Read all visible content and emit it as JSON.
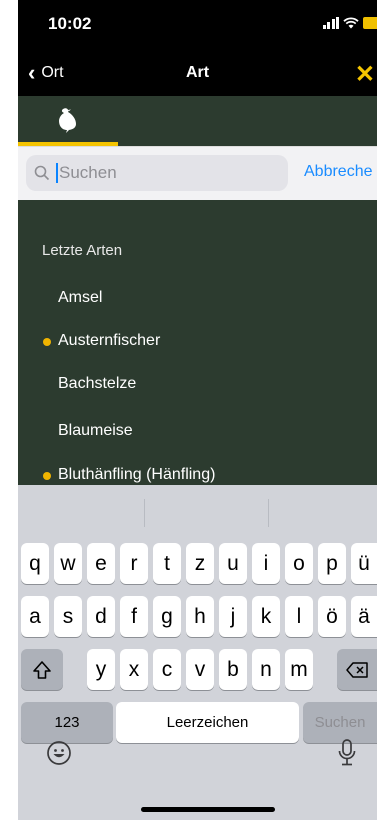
{
  "status": {
    "time": "10:02"
  },
  "nav": {
    "back_label": "Ort",
    "title": "Art",
    "close_symbol": "✕"
  },
  "tabs": [
    {
      "icon": "bird-icon",
      "active": true
    }
  ],
  "search": {
    "placeholder": "Suchen",
    "cancel_label": "Abbreche"
  },
  "list": {
    "section_title": "Letzte Arten",
    "items": [
      {
        "label": "Amsel",
        "marked": false
      },
      {
        "label": "Austernfischer",
        "marked": true
      },
      {
        "label": "Bachstelze",
        "marked": false
      },
      {
        "label": "Blaumeise",
        "marked": false
      },
      {
        "label": "Bluthänfling (Hänfling)",
        "marked": true
      }
    ]
  },
  "keyboard": {
    "row1": [
      "q",
      "w",
      "e",
      "r",
      "t",
      "z",
      "u",
      "i",
      "o",
      "p",
      "ü"
    ],
    "row2": [
      "a",
      "s",
      "d",
      "f",
      "g",
      "h",
      "j",
      "k",
      "l",
      "ö",
      "ä"
    ],
    "row3": [
      "y",
      "x",
      "c",
      "v",
      "b",
      "n",
      "m"
    ],
    "numbers_label": "123",
    "space_label": "Leerzeichen",
    "search_label": "Suchen"
  },
  "colors": {
    "accent": "#f5c400",
    "list_bg": "#2c3b2f",
    "link": "#1a8cff"
  }
}
